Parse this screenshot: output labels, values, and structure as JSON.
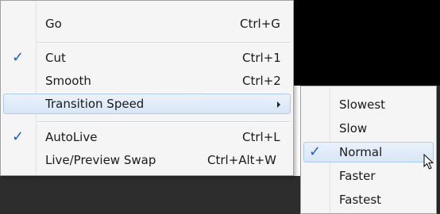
{
  "menu": {
    "items": [
      {
        "label": "Go",
        "shortcut": "Ctrl+G",
        "checked": false
      },
      {
        "label": "Cut",
        "shortcut": "Ctrl+1",
        "checked": true
      },
      {
        "label": "Smooth",
        "shortcut": "Ctrl+2",
        "checked": false
      },
      {
        "label": "Transition Speed",
        "shortcut": "",
        "checked": false,
        "submenu": true
      },
      {
        "label": "AutoLive",
        "shortcut": "Ctrl+L",
        "checked": true
      },
      {
        "label": "Live/Preview Swap",
        "shortcut": "Ctrl+Alt+W",
        "checked": false
      }
    ]
  },
  "submenu": {
    "items": [
      {
        "label": "Slowest",
        "checked": false
      },
      {
        "label": "Slow",
        "checked": false
      },
      {
        "label": "Normal",
        "checked": true
      },
      {
        "label": "Faster",
        "checked": false
      },
      {
        "label": "Fastest",
        "checked": false
      }
    ]
  },
  "icons": {
    "check": "checkmark-icon",
    "submenu_arrow": "submenu-arrow-icon",
    "cursor": "mouse-pointer-icon"
  },
  "colors": {
    "highlight": "#d9e6f7",
    "check": "#1f5ecf",
    "background_top": "#000000",
    "background_bottom": "#2d2d2d"
  }
}
